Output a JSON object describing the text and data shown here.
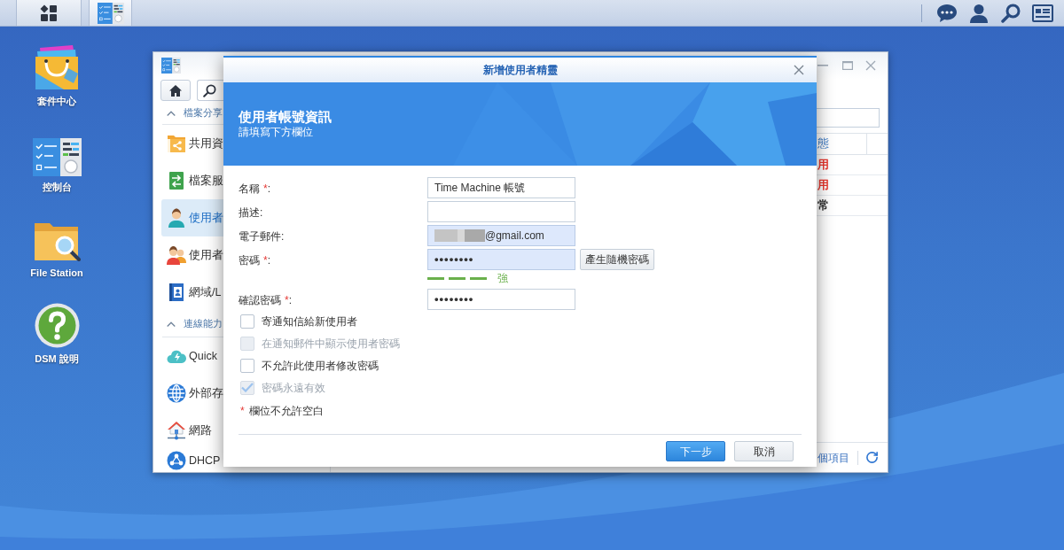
{
  "desktop_icons": [
    {
      "kind": "package",
      "label": "套件中心"
    },
    {
      "kind": "control",
      "label": "控制台"
    },
    {
      "kind": "files",
      "label": "File Station"
    },
    {
      "kind": "help",
      "label": "DSM 說明"
    }
  ],
  "control_panel": {
    "sidebar": [
      {
        "label": "檔案分享",
        "expanded": true,
        "items": [
          {
            "label": "共用資",
            "selected": false
          },
          {
            "label": "檔案服",
            "selected": false
          },
          {
            "label": "使用者",
            "selected": true
          },
          {
            "label": "使用者",
            "selected": false
          },
          {
            "label": "網域/L",
            "selected": false
          }
        ]
      },
      {
        "label": "連線能力",
        "expanded": true,
        "items": [
          {
            "label": "Quick",
            "selected": false
          },
          {
            "label": "外部存",
            "selected": false
          },
          {
            "label": "網路",
            "selected": false
          },
          {
            "label": "DHCP",
            "selected": false
          }
        ]
      }
    ],
    "table": {
      "columns": [
        "態"
      ],
      "rows": [
        {
          "cells": [
            "用"
          ],
          "color": "#e8372e"
        },
        {
          "cells": [
            "用"
          ],
          "color": "#e8372e"
        },
        {
          "cells": [
            "常"
          ],
          "color": "#333333"
        }
      ]
    },
    "footer_text": "個項目"
  },
  "dialog": {
    "title": "新增使用者精靈",
    "heading": "使用者帳號資訊",
    "subheading": "請填寫下方欄位",
    "fields": [
      {
        "kind": "text",
        "label": "名稱",
        "required_mark": "*",
        "colon": ":",
        "value": "Time Machine 帳號",
        "autofilled": false
      },
      {
        "kind": "text",
        "label": "描述",
        "colon": ":",
        "autofilled": false
      },
      {
        "kind": "email",
        "label": "電子郵件",
        "colon": ":",
        "redacted": true,
        "value": "@gmail.com",
        "autofilled": true
      },
      {
        "kind": "password",
        "label": "密碼",
        "required_mark": "*",
        "colon": ":",
        "value": "••••••••",
        "autofilled": true,
        "button": "產生隨機密碼",
        "strength": {
          "level": 1,
          "label": "強"
        }
      },
      {
        "kind": "password",
        "label": "確認密碼",
        "required_mark": "*",
        "colon": ":",
        "value": "••••••••",
        "autofilled": false
      }
    ],
    "options": [
      {
        "label": "寄通知信給新使用者",
        "checked": false,
        "disabled": false
      },
      {
        "label": "在通知郵件中顯示使用者密碼",
        "checked": false,
        "disabled": true
      },
      {
        "label": "不允許此使用者修改密碼",
        "checked": false,
        "disabled": false
      },
      {
        "label": "密碼永遠有效",
        "checked": true,
        "disabled": true
      }
    ],
    "required_note": {
      "mark": "*",
      "text": "欄位不允許空白"
    },
    "buttons": [
      {
        "label": "下一步",
        "primary": true
      },
      {
        "label": "取消",
        "primary": false
      }
    ]
  }
}
